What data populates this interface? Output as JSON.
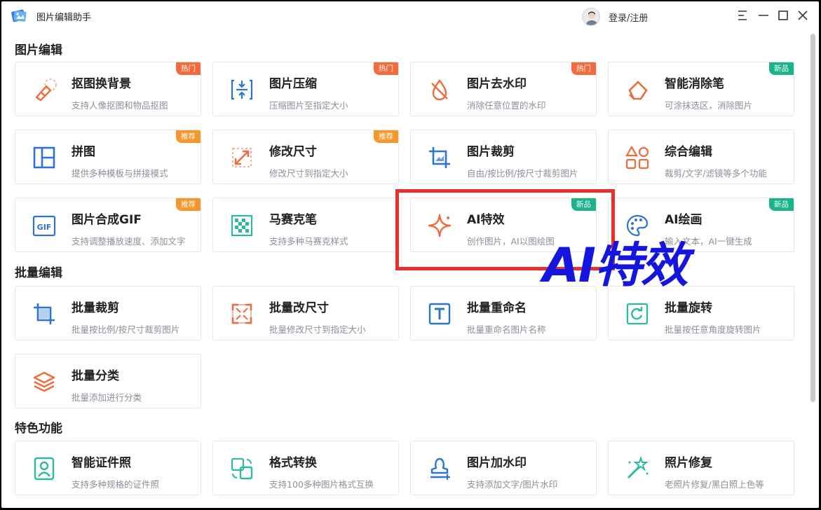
{
  "window": {
    "title": "图片编辑助手",
    "login": "登录/注册"
  },
  "colors": {
    "hot": "#f46a3b",
    "new": "#1ab38b",
    "rec": "#f7962b",
    "orange_icon": "#ee6b3c",
    "blue_icon": "#2b74d6",
    "teal_icon": "#2bb9a0",
    "overlay_text": "#1416e0",
    "highlight": "#e8312f"
  },
  "sections": {
    "edit": "图片编辑",
    "batch": "批量编辑",
    "special": "特色功能"
  },
  "cards": [
    {
      "title": "抠图换背景",
      "desc": "支持人像抠图和物品抠图",
      "badge": "热门",
      "badge_type": "hot",
      "icon": "eraser-icon"
    },
    {
      "title": "图片压缩",
      "desc": "压缩图片至指定大小",
      "badge": "热门",
      "badge_type": "hot",
      "icon": "compress-icon"
    },
    {
      "title": "图片去水印",
      "desc": "消除任意位置的水印",
      "badge": "热门",
      "badge_type": "hot",
      "icon": "no-watermark-icon"
    },
    {
      "title": "智能消除笔",
      "desc": "可涂抹选区，消除图片",
      "badge": "新品",
      "badge_type": "new",
      "icon": "magic-eraser-icon"
    },
    {
      "title": "拼图",
      "desc": "提供多种模板与拼接模式",
      "badge": "推荐",
      "badge_type": "rec",
      "icon": "collage-icon"
    },
    {
      "title": "修改尺寸",
      "desc": "修改尺寸到指定大小",
      "badge": "推荐",
      "badge_type": "rec",
      "icon": "resize-icon"
    },
    {
      "title": "图片裁剪",
      "desc": "自由/按比例/按尺寸裁剪图片",
      "badge": "",
      "badge_type": "",
      "icon": "crop-icon"
    },
    {
      "title": "综合编辑",
      "desc": "裁剪/文字/滤镜等多个功能",
      "badge": "",
      "badge_type": "",
      "icon": "shapes-icon"
    },
    {
      "title": "图片合成GIF",
      "desc": "支持调整播放速度、添加文字",
      "badge": "推荐",
      "badge_type": "rec",
      "icon": "gif-icon"
    },
    {
      "title": "马赛克笔",
      "desc": "支持多种马赛克样式",
      "badge": "",
      "badge_type": "",
      "icon": "mosaic-icon"
    },
    {
      "title": "AI特效",
      "desc": "创作图片，AI以图绘图",
      "badge": "新品",
      "badge_type": "new",
      "icon": "sparkle-icon"
    },
    {
      "title": "AI绘画",
      "desc": "输入文本，AI一键生成",
      "badge": "新品",
      "badge_type": "new",
      "icon": "palette-icon"
    },
    {
      "title": "批量裁剪",
      "desc": "批量按比例/按尺寸裁剪图片",
      "badge": "",
      "badge_type": "",
      "icon": "batch-crop-icon"
    },
    {
      "title": "批量改尺寸",
      "desc": "批量修改尺寸到指定大小",
      "badge": "",
      "badge_type": "",
      "icon": "batch-resize-icon"
    },
    {
      "title": "批量重命名",
      "desc": "批量重命名图片名称",
      "badge": "",
      "badge_type": "",
      "icon": "rename-icon"
    },
    {
      "title": "批量旋转",
      "desc": "批量按任意角度旋转图片",
      "badge": "",
      "badge_type": "",
      "icon": "rotate-icon"
    },
    {
      "title": "批量分类",
      "desc": "批量添加进行分类",
      "badge": "",
      "badge_type": "",
      "icon": "layers-icon"
    },
    {
      "title": "智能证件照",
      "desc": "支持多种规格的证件照",
      "badge": "",
      "badge_type": "",
      "icon": "id-photo-icon"
    },
    {
      "title": "格式转换",
      "desc": "支持100多种图片格式互换",
      "badge": "",
      "badge_type": "",
      "icon": "convert-icon"
    },
    {
      "title": "图片加水印",
      "desc": "支持添加文字/图片水印",
      "badge": "",
      "badge_type": "",
      "icon": "stamp-icon"
    },
    {
      "title": "照片修复",
      "desc": "老照片修复/黑白照上色等",
      "badge": "",
      "badge_type": "",
      "icon": "magic-wand-icon"
    }
  ],
  "overlay": {
    "text": "AI特效"
  }
}
